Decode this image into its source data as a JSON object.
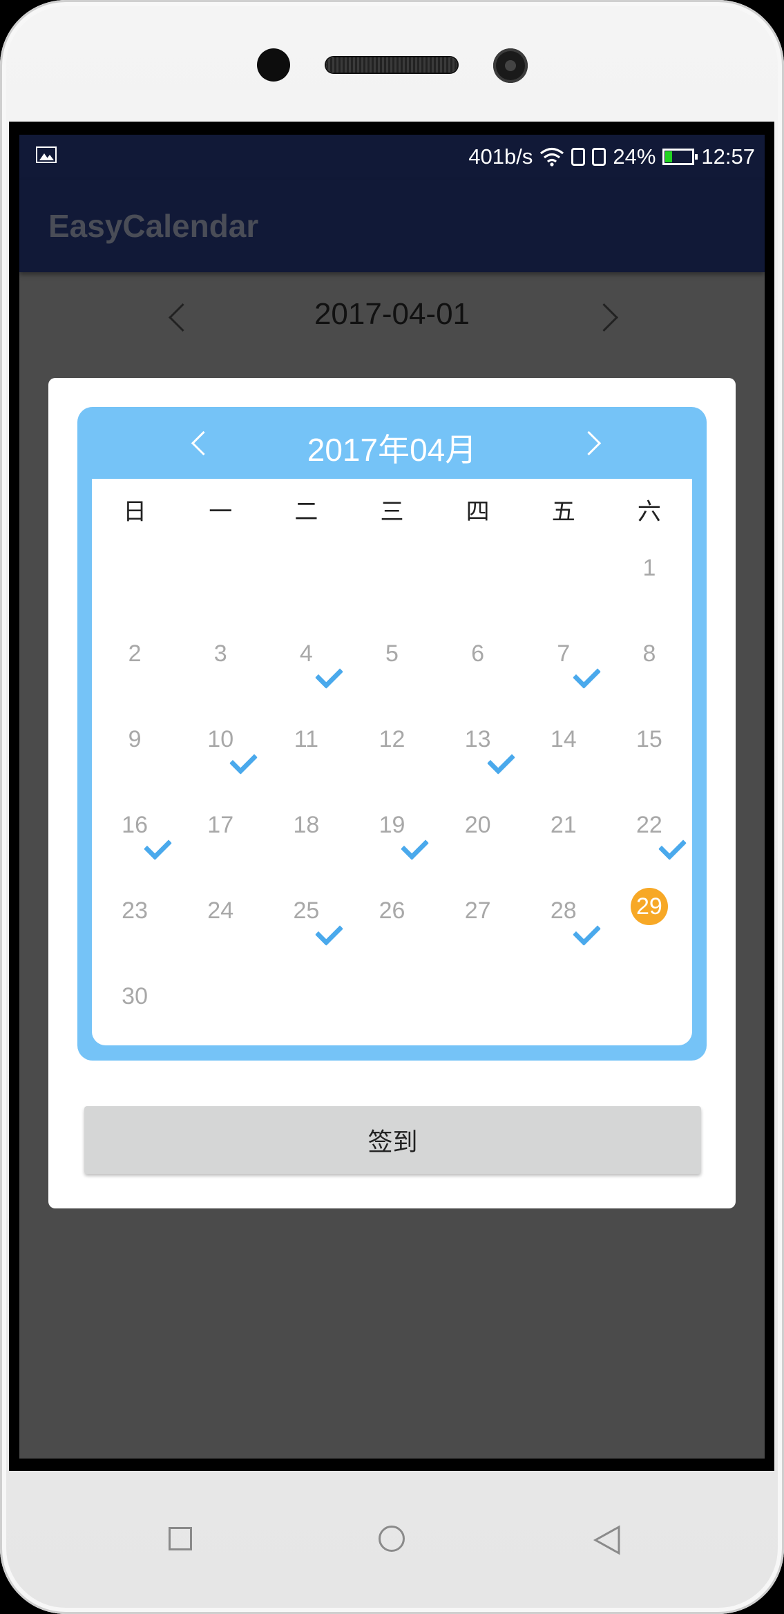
{
  "status_bar": {
    "net_speed": "401b/s",
    "battery_percent": "24%",
    "time": "12:57",
    "battery_level": 0.24,
    "icons": [
      "image-icon",
      "wifi-icon",
      "sim-icon",
      "sim-icon",
      "battery-icon"
    ]
  },
  "app_bar": {
    "title": "EasyCalendar"
  },
  "date_nav": {
    "date": "2017-04-01"
  },
  "calendar": {
    "month_title": "2017年04月",
    "weekdays": [
      "日",
      "一",
      "二",
      "三",
      "四",
      "五",
      "六"
    ],
    "weeks": [
      [
        "",
        "",
        "",
        "",
        "",
        "",
        "1"
      ],
      [
        "2",
        "3",
        "4",
        "5",
        "6",
        "7",
        "8"
      ],
      [
        "9",
        "10",
        "11",
        "12",
        "13",
        "14",
        "15"
      ],
      [
        "16",
        "17",
        "18",
        "19",
        "20",
        "21",
        "22"
      ],
      [
        "23",
        "24",
        "25",
        "26",
        "27",
        "28",
        "29"
      ],
      [
        "30",
        "",
        "",
        "",
        "",
        "",
        ""
      ]
    ],
    "checked_days": [
      "4",
      "7",
      "10",
      "13",
      "16",
      "19",
      "22",
      "25",
      "28"
    ],
    "today": "29",
    "colors": {
      "frame": "#75c3f7",
      "check": "#4aa9ec",
      "today": "#f7a826"
    }
  },
  "sign_in_button": {
    "label": "签到"
  }
}
